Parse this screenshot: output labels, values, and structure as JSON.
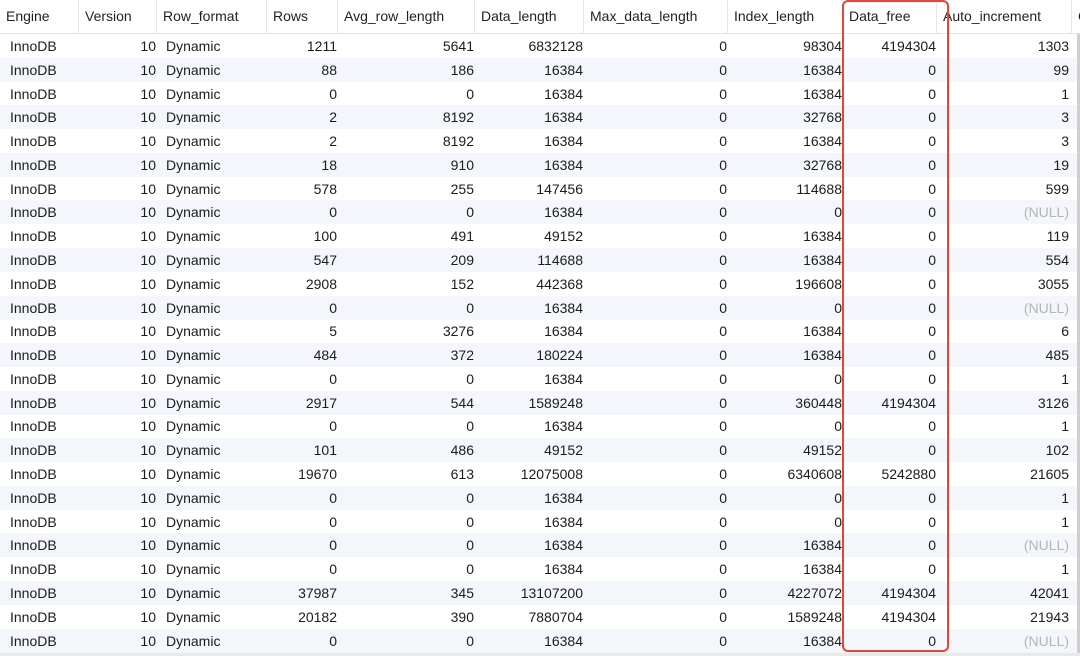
{
  "columns": [
    "Engine",
    "Version",
    "Row_format",
    "Rows",
    "Avg_row_length",
    "Data_length",
    "Max_data_length",
    "Index_length",
    "Data_free",
    "Auto_increment",
    "C"
  ],
  "rows": [
    [
      "InnoDB",
      "10",
      "Dynamic",
      "1211",
      "5641",
      "6832128",
      "0",
      "98304",
      "4194304",
      "1303"
    ],
    [
      "InnoDB",
      "10",
      "Dynamic",
      "88",
      "186",
      "16384",
      "0",
      "16384",
      "0",
      "99"
    ],
    [
      "InnoDB",
      "10",
      "Dynamic",
      "0",
      "0",
      "16384",
      "0",
      "16384",
      "0",
      "1"
    ],
    [
      "InnoDB",
      "10",
      "Dynamic",
      "2",
      "8192",
      "16384",
      "0",
      "32768",
      "0",
      "3"
    ],
    [
      "InnoDB",
      "10",
      "Dynamic",
      "2",
      "8192",
      "16384",
      "0",
      "16384",
      "0",
      "3"
    ],
    [
      "InnoDB",
      "10",
      "Dynamic",
      "18",
      "910",
      "16384",
      "0",
      "32768",
      "0",
      "19"
    ],
    [
      "InnoDB",
      "10",
      "Dynamic",
      "578",
      "255",
      "147456",
      "0",
      "114688",
      "0",
      "599"
    ],
    [
      "InnoDB",
      "10",
      "Dynamic",
      "0",
      "0",
      "16384",
      "0",
      "0",
      "0",
      "(NULL)"
    ],
    [
      "InnoDB",
      "10",
      "Dynamic",
      "100",
      "491",
      "49152",
      "0",
      "16384",
      "0",
      "119"
    ],
    [
      "InnoDB",
      "10",
      "Dynamic",
      "547",
      "209",
      "114688",
      "0",
      "16384",
      "0",
      "554"
    ],
    [
      "InnoDB",
      "10",
      "Dynamic",
      "2908",
      "152",
      "442368",
      "0",
      "196608",
      "0",
      "3055"
    ],
    [
      "InnoDB",
      "10",
      "Dynamic",
      "0",
      "0",
      "16384",
      "0",
      "0",
      "0",
      "(NULL)"
    ],
    [
      "InnoDB",
      "10",
      "Dynamic",
      "5",
      "3276",
      "16384",
      "0",
      "16384",
      "0",
      "6"
    ],
    [
      "InnoDB",
      "10",
      "Dynamic",
      "484",
      "372",
      "180224",
      "0",
      "16384",
      "0",
      "485"
    ],
    [
      "InnoDB",
      "10",
      "Dynamic",
      "0",
      "0",
      "16384",
      "0",
      "0",
      "0",
      "1"
    ],
    [
      "InnoDB",
      "10",
      "Dynamic",
      "2917",
      "544",
      "1589248",
      "0",
      "360448",
      "4194304",
      "3126"
    ],
    [
      "InnoDB",
      "10",
      "Dynamic",
      "0",
      "0",
      "16384",
      "0",
      "0",
      "0",
      "1"
    ],
    [
      "InnoDB",
      "10",
      "Dynamic",
      "101",
      "486",
      "49152",
      "0",
      "49152",
      "0",
      "102"
    ],
    [
      "InnoDB",
      "10",
      "Dynamic",
      "19670",
      "613",
      "12075008",
      "0",
      "6340608",
      "5242880",
      "21605"
    ],
    [
      "InnoDB",
      "10",
      "Dynamic",
      "0",
      "0",
      "16384",
      "0",
      "0",
      "0",
      "1"
    ],
    [
      "InnoDB",
      "10",
      "Dynamic",
      "0",
      "0",
      "16384",
      "0",
      "0",
      "0",
      "1"
    ],
    [
      "InnoDB",
      "10",
      "Dynamic",
      "0",
      "0",
      "16384",
      "0",
      "16384",
      "0",
      "(NULL)"
    ],
    [
      "InnoDB",
      "10",
      "Dynamic",
      "0",
      "0",
      "16384",
      "0",
      "16384",
      "0",
      "1"
    ],
    [
      "InnoDB",
      "10",
      "Dynamic",
      "37987",
      "345",
      "13107200",
      "0",
      "4227072",
      "4194304",
      "42041"
    ],
    [
      "InnoDB",
      "10",
      "Dynamic",
      "20182",
      "390",
      "7880704",
      "0",
      "1589248",
      "4194304",
      "21943"
    ],
    [
      "InnoDB",
      "10",
      "Dynamic",
      "0",
      "0",
      "16384",
      "0",
      "16384",
      "0",
      "(NULL)"
    ]
  ],
  "colors": {
    "highlight": "#e0463a",
    "alt_row": "#f3f6fa",
    "null_text": "#b5b5b5"
  }
}
